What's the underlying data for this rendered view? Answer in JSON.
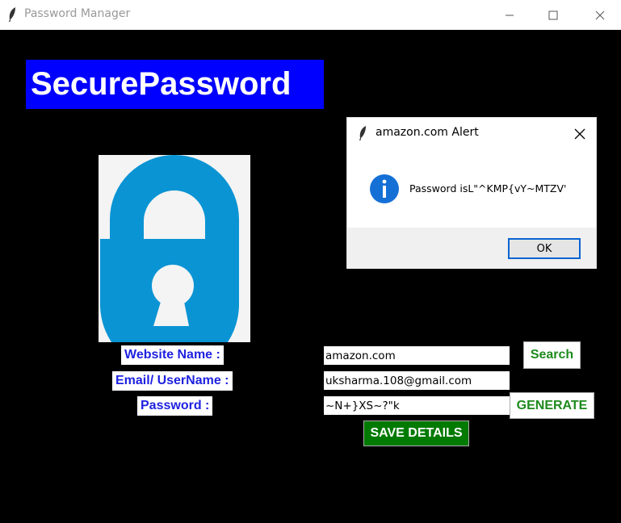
{
  "window": {
    "title": "Password Manager",
    "icon": "feather-icon"
  },
  "brand": {
    "title": "SecurePassword",
    "background": "#0000ff"
  },
  "lock_image": {
    "icon": "padlock-open-icon",
    "color": "#0a94d4"
  },
  "form": {
    "website_label": "Website Name :",
    "email_label": "Email/ UserName :",
    "password_label": "Password :",
    "website_value": "amazon.com",
    "email_value": "uksharma.108@gmail.com",
    "password_value": "~N+}XS~?\"k",
    "search_label": "Search",
    "generate_label": "GENERATE",
    "save_label": "SAVE DETAILS",
    "label_color": "#1f22e0",
    "action_color": "#1d8a1d",
    "save_bg": "#007a00"
  },
  "alert": {
    "title": "amazon.com Alert",
    "message": "Password isL\"^KMP{vY~MTZV'",
    "ok_label": "OK",
    "icon": "info-icon"
  }
}
